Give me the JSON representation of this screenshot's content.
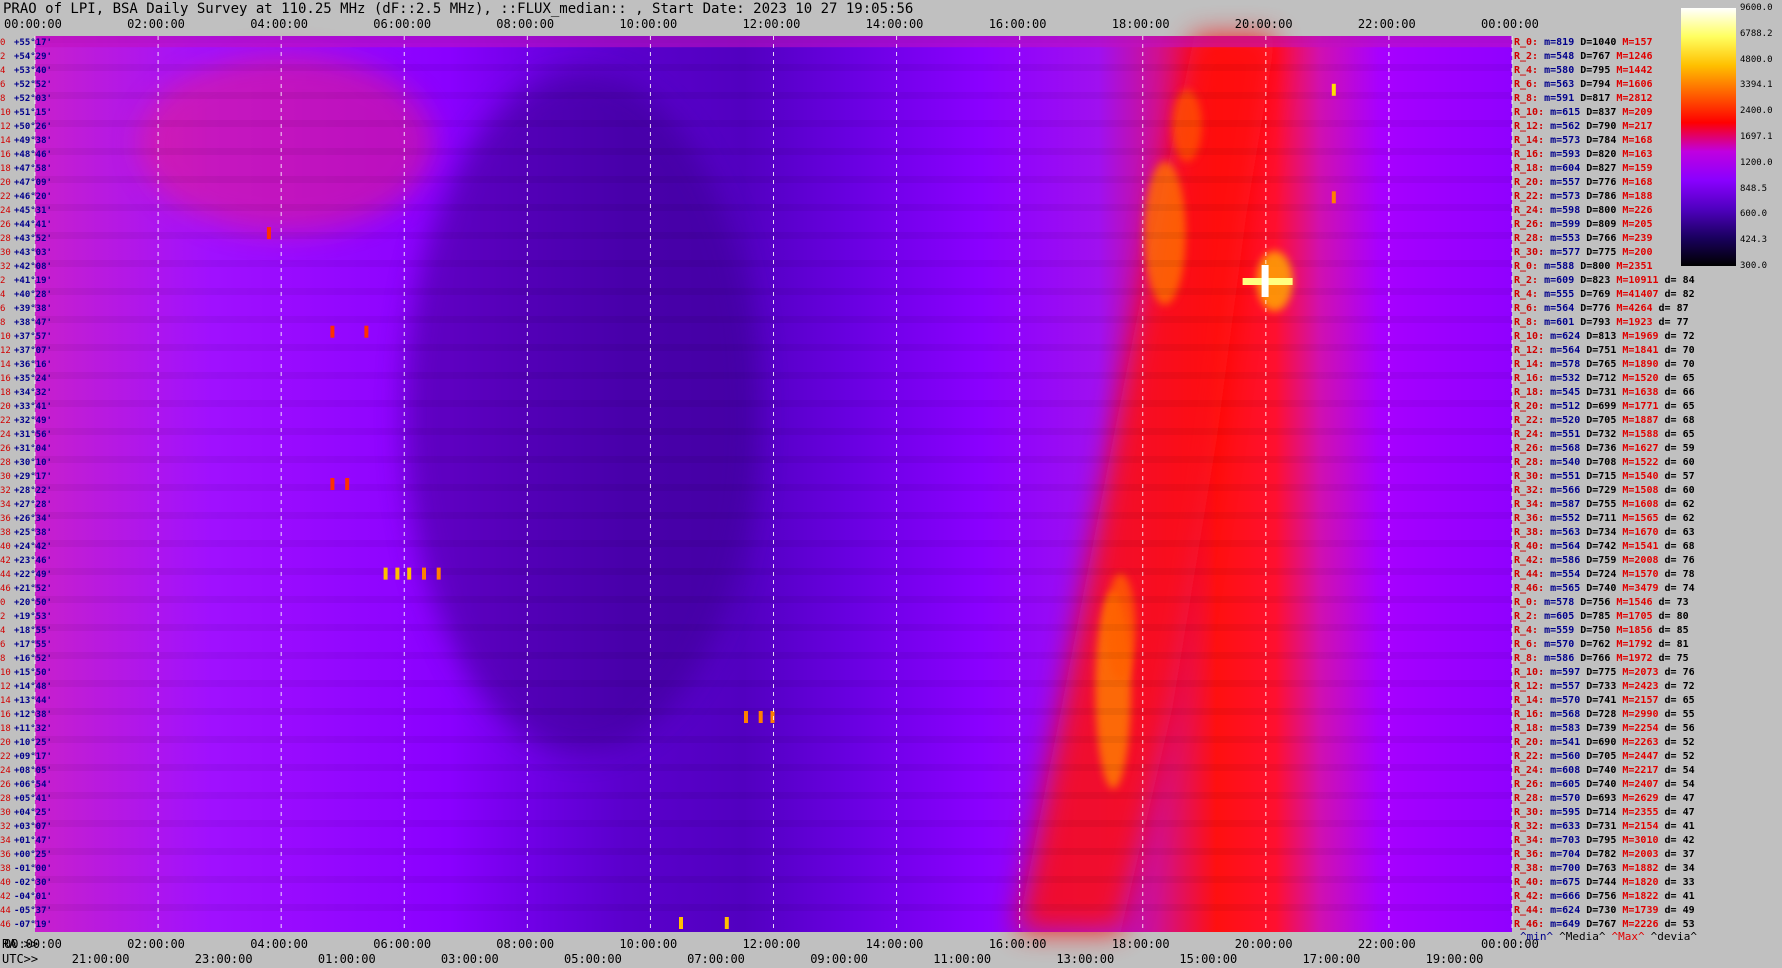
{
  "header": {
    "title": "PRAO of LPI, BSA Daily Survey at 110.25 MHz (dF::2.5 MHz), ::FLUX_median:: , Start Date: 2023 10 27 19:05:56"
  },
  "axes": {
    "top_ticks": [
      "00:00:00",
      "02:00:00",
      "04:00:00",
      "06:00:00",
      "08:00:00",
      "10:00:00",
      "12:00:00",
      "14:00:00",
      "16:00:00",
      "18:00:00",
      "20:00:00",
      "22:00:00",
      "00:00:00"
    ],
    "bottom_ra_prefix": "RA >>",
    "bottom_ra_ticks": [
      "00:00:00",
      "02:00:00",
      "04:00:00",
      "06:00:00",
      "08:00:00",
      "10:00:00",
      "12:00:00",
      "14:00:00",
      "16:00:00",
      "18:00:00",
      "20:00:00",
      "22:00:00",
      "00:00:00"
    ],
    "bottom_utc_prefix": "UTC>>",
    "bottom_utc_ticks": [
      "21:00:00",
      "23:00:00",
      "01:00:00",
      "03:00:00",
      "05:00:00",
      "07:00:00",
      "09:00:00",
      "11:00:00",
      "13:00:00",
      "15:00:00",
      "17:00:00",
      "19:00:00"
    ]
  },
  "declinations": [
    {
      "i": "0",
      "d": "+55°17'"
    },
    {
      "i": "2",
      "d": "+54°29'"
    },
    {
      "i": "4",
      "d": "+53°40'"
    },
    {
      "i": "6",
      "d": "+52°52'"
    },
    {
      "i": "8",
      "d": "+52°03'"
    },
    {
      "i": "10",
      "d": "+51°15'"
    },
    {
      "i": "12",
      "d": "+50°26'"
    },
    {
      "i": "14",
      "d": "+49°38'"
    },
    {
      "i": "16",
      "d": "+48°46'"
    },
    {
      "i": "18",
      "d": "+47°58'"
    },
    {
      "i": "20",
      "d": "+47°09'"
    },
    {
      "i": "22",
      "d": "+46°20'"
    },
    {
      "i": "24",
      "d": "+45°31'"
    },
    {
      "i": "26",
      "d": "+44°41'"
    },
    {
      "i": "28",
      "d": "+43°52'"
    },
    {
      "i": "30",
      "d": "+43°03'"
    },
    {
      "i": "32",
      "d": "+42°08'"
    },
    {
      "i": "2",
      "d": "+41°19'"
    },
    {
      "i": "4",
      "d": "+40°28'"
    },
    {
      "i": "6",
      "d": "+39°38'"
    },
    {
      "i": "8",
      "d": "+38°47'"
    },
    {
      "i": "10",
      "d": "+37°57'"
    },
    {
      "i": "12",
      "d": "+37°07'"
    },
    {
      "i": "14",
      "d": "+36°16'"
    },
    {
      "i": "16",
      "d": "+35°24'"
    },
    {
      "i": "18",
      "d": "+34°32'"
    },
    {
      "i": "20",
      "d": "+33°41'"
    },
    {
      "i": "22",
      "d": "+32°49'"
    },
    {
      "i": "24",
      "d": "+31°56'"
    },
    {
      "i": "26",
      "d": "+31°04'"
    },
    {
      "i": "28",
      "d": "+30°10'"
    },
    {
      "i": "30",
      "d": "+29°17'"
    },
    {
      "i": "32",
      "d": "+28°22'"
    },
    {
      "i": "34",
      "d": "+27°28'"
    },
    {
      "i": "36",
      "d": "+26°34'"
    },
    {
      "i": "38",
      "d": "+25°38'"
    },
    {
      "i": "40",
      "d": "+24°42'"
    },
    {
      "i": "42",
      "d": "+23°46'"
    },
    {
      "i": "44",
      "d": "+22°49'"
    },
    {
      "i": "46",
      "d": "+21°52'"
    },
    {
      "i": "0",
      "d": "+20°50'"
    },
    {
      "i": "2",
      "d": "+19°53'"
    },
    {
      "i": "4",
      "d": "+18°55'"
    },
    {
      "i": "6",
      "d": "+17°55'"
    },
    {
      "i": "8",
      "d": "+16°52'"
    },
    {
      "i": "10",
      "d": "+15°50'"
    },
    {
      "i": "12",
      "d": "+14°48'"
    },
    {
      "i": "14",
      "d": "+13°44'"
    },
    {
      "i": "16",
      "d": "+12°38'"
    },
    {
      "i": "18",
      "d": "+11°32'"
    },
    {
      "i": "20",
      "d": "+10°25'"
    },
    {
      "i": "22",
      "d": "+09°17'"
    },
    {
      "i": "24",
      "d": "+08°05'"
    },
    {
      "i": "26",
      "d": "+06°54'"
    },
    {
      "i": "28",
      "d": "+05°41'"
    },
    {
      "i": "30",
      "d": "+04°25'"
    },
    {
      "i": "32",
      "d": "+03°07'"
    },
    {
      "i": "34",
      "d": "+01°47'"
    },
    {
      "i": "36",
      "d": "+00°25'"
    },
    {
      "i": "38",
      "d": "-01°00'"
    },
    {
      "i": "40",
      "d": "-02°30'"
    },
    {
      "i": "42",
      "d": "-04°01'"
    },
    {
      "i": "44",
      "d": "-05°37'"
    },
    {
      "i": "46",
      "d": "-07°19'"
    }
  ],
  "stats": [
    {
      "l": "R_0:",
      "m": "m=819",
      "D": "D=1040",
      "M": "M=157",
      "d": ""
    },
    {
      "l": "R_2:",
      "m": "m=548",
      "D": "D=767",
      "M": "M=1246",
      "d": ""
    },
    {
      "l": "R_4:",
      "m": "m=580",
      "D": "D=795",
      "M": "M=1442",
      "d": ""
    },
    {
      "l": "R_6:",
      "m": "m=563",
      "D": "D=794",
      "M": "M=1606",
      "d": ""
    },
    {
      "l": "R_8:",
      "m": "m=591",
      "D": "D=817",
      "M": "M=2812",
      "d": ""
    },
    {
      "l": "R_10:",
      "m": "m=615",
      "D": "D=837",
      "M": "M=209",
      "d": ""
    },
    {
      "l": "R_12:",
      "m": "m=562",
      "D": "D=790",
      "M": "M=217",
      "d": ""
    },
    {
      "l": "R_14:",
      "m": "m=573",
      "D": "D=784",
      "M": "M=168",
      "d": ""
    },
    {
      "l": "R_16:",
      "m": "m=593",
      "D": "D=820",
      "M": "M=163",
      "d": ""
    },
    {
      "l": "R_18:",
      "m": "m=604",
      "D": "D=827",
      "M": "M=159",
      "d": ""
    },
    {
      "l": "R_20:",
      "m": "m=557",
      "D": "D=776",
      "M": "M=168",
      "d": ""
    },
    {
      "l": "R_22:",
      "m": "m=573",
      "D": "D=786",
      "M": "M=188",
      "d": ""
    },
    {
      "l": "R_24:",
      "m": "m=598",
      "D": "D=800",
      "M": "M=226",
      "d": ""
    },
    {
      "l": "R_26:",
      "m": "m=599",
      "D": "D=809",
      "M": "M=205",
      "d": ""
    },
    {
      "l": "R_28:",
      "m": "m=553",
      "D": "D=766",
      "M": "M=239",
      "d": ""
    },
    {
      "l": "R_30:",
      "m": "m=577",
      "D": "D=775",
      "M": "M=200",
      "d": ""
    },
    {
      "l": "R_0:",
      "m": "m=588",
      "D": "D=800",
      "M": "M=2351",
      "d": ""
    },
    {
      "l": "R_2:",
      "m": "m=609",
      "D": "D=823",
      "M": "M=10911",
      "d": "d= 84"
    },
    {
      "l": "R_4:",
      "m": "m=555",
      "D": "D=769",
      "M": "M=41407",
      "d": "d= 82"
    },
    {
      "l": "R_6:",
      "m": "m=564",
      "D": "D=776",
      "M": "M=4264",
      "d": "d= 87"
    },
    {
      "l": "R_8:",
      "m": "m=601",
      "D": "D=793",
      "M": "M=1923",
      "d": "d= 77"
    },
    {
      "l": "R_10:",
      "m": "m=624",
      "D": "D=813",
      "M": "M=1969",
      "d": "d= 72"
    },
    {
      "l": "R_12:",
      "m": "m=564",
      "D": "D=751",
      "M": "M=1841",
      "d": "d= 70"
    },
    {
      "l": "R_14:",
      "m": "m=578",
      "D": "D=765",
      "M": "M=1890",
      "d": "d= 70"
    },
    {
      "l": "R_16:",
      "m": "m=532",
      "D": "D=712",
      "M": "M=1520",
      "d": "d= 65"
    },
    {
      "l": "R_18:",
      "m": "m=545",
      "D": "D=731",
      "M": "M=1638",
      "d": "d= 66"
    },
    {
      "l": "R_20:",
      "m": "m=512",
      "D": "D=699",
      "M": "M=1771",
      "d": "d= 65"
    },
    {
      "l": "R_22:",
      "m": "m=520",
      "D": "D=705",
      "M": "M=1887",
      "d": "d= 68"
    },
    {
      "l": "R_24:",
      "m": "m=551",
      "D": "D=732",
      "M": "M=1588",
      "d": "d= 65"
    },
    {
      "l": "R_26:",
      "m": "m=568",
      "D": "D=736",
      "M": "M=1627",
      "d": "d= 59"
    },
    {
      "l": "R_28:",
      "m": "m=540",
      "D": "D=708",
      "M": "M=1522",
      "d": "d= 60"
    },
    {
      "l": "R_30:",
      "m": "m=551",
      "D": "D=715",
      "M": "M=1540",
      "d": "d= 57"
    },
    {
      "l": "R_32:",
      "m": "m=566",
      "D": "D=729",
      "M": "M=1508",
      "d": "d= 60"
    },
    {
      "l": "R_34:",
      "m": "m=587",
      "D": "D=755",
      "M": "M=1608",
      "d": "d= 62"
    },
    {
      "l": "R_36:",
      "m": "m=552",
      "D": "D=711",
      "M": "M=1565",
      "d": "d= 62"
    },
    {
      "l": "R_38:",
      "m": "m=563",
      "D": "D=734",
      "M": "M=1670",
      "d": "d= 63"
    },
    {
      "l": "R_40:",
      "m": "m=564",
      "D": "D=742",
      "M": "M=1541",
      "d": "d= 68"
    },
    {
      "l": "R_42:",
      "m": "m=586",
      "D": "D=759",
      "M": "M=2008",
      "d": "d= 76"
    },
    {
      "l": "R_44:",
      "m": "m=554",
      "D": "D=724",
      "M": "M=1570",
      "d": "d= 78"
    },
    {
      "l": "R_46:",
      "m": "m=565",
      "D": "D=740",
      "M": "M=3479",
      "d": "d= 74"
    },
    {
      "l": "R_0:",
      "m": "m=578",
      "D": "D=756",
      "M": "M=1546",
      "d": "d= 73"
    },
    {
      "l": "R_2:",
      "m": "m=605",
      "D": "D=785",
      "M": "M=1705",
      "d": "d= 80"
    },
    {
      "l": "R_4:",
      "m": "m=559",
      "D": "D=750",
      "M": "M=1856",
      "d": "d= 85"
    },
    {
      "l": "R_6:",
      "m": "m=570",
      "D": "D=762",
      "M": "M=1792",
      "d": "d= 81"
    },
    {
      "l": "R_8:",
      "m": "m=586",
      "D": "D=766",
      "M": "M=1972",
      "d": "d= 75"
    },
    {
      "l": "R_10:",
      "m": "m=597",
      "D": "D=775",
      "M": "M=2073",
      "d": "d= 76"
    },
    {
      "l": "R_12:",
      "m": "m=557",
      "D": "D=733",
      "M": "M=2423",
      "d": "d= 72"
    },
    {
      "l": "R_14:",
      "m": "m=570",
      "D": "D=741",
      "M": "M=2157",
      "d": "d= 65"
    },
    {
      "l": "R_16:",
      "m": "m=568",
      "D": "D=728",
      "M": "M=2990",
      "d": "d= 55"
    },
    {
      "l": "R_18:",
      "m": "m=583",
      "D": "D=739",
      "M": "M=2254",
      "d": "d= 56"
    },
    {
      "l": "R_20:",
      "m": "m=541",
      "D": "D=690",
      "M": "M=2263",
      "d": "d= 52"
    },
    {
      "l": "R_22:",
      "m": "m=560",
      "D": "D=705",
      "M": "M=2447",
      "d": "d= 52"
    },
    {
      "l": "R_24:",
      "m": "m=608",
      "D": "D=740",
      "M": "M=2217",
      "d": "d= 54"
    },
    {
      "l": "R_26:",
      "m": "m=605",
      "D": "D=740",
      "M": "M=2407",
      "d": "d= 54"
    },
    {
      "l": "R_28:",
      "m": "m=570",
      "D": "D=693",
      "M": "M=2629",
      "d": "d= 47"
    },
    {
      "l": "R_30:",
      "m": "m=595",
      "D": "D=714",
      "M": "M=2355",
      "d": "d= 47"
    },
    {
      "l": "R_32:",
      "m": "m=633",
      "D": "D=731",
      "M": "M=2154",
      "d": "d= 41"
    },
    {
      "l": "R_34:",
      "m": "m=703",
      "D": "D=795",
      "M": "M=3010",
      "d": "d= 42"
    },
    {
      "l": "R_36:",
      "m": "m=704",
      "D": "D=782",
      "M": "M=2003",
      "d": "d= 37"
    },
    {
      "l": "R_38:",
      "m": "m=700",
      "D": "D=763",
      "M": "M=1882",
      "d": "d= 34"
    },
    {
      "l": "R_40:",
      "m": "m=675",
      "D": "D=744",
      "M": "M=1820",
      "d": "d= 33"
    },
    {
      "l": "R_42:",
      "m": "m=666",
      "D": "D=756",
      "M": "M=1822",
      "d": "d= 41"
    },
    {
      "l": "R_44:",
      "m": "m=624",
      "D": "D=730",
      "M": "M=1739",
      "d": "d= 49"
    },
    {
      "l": "R_46:",
      "m": "m=649",
      "D": "D=767",
      "M": "M=2226",
      "d": "d= 53"
    }
  ],
  "legend_keys": [
    {
      "text": "^min^",
      "color": "#00008b"
    },
    {
      "text": "^Media^",
      "color": "#000000"
    },
    {
      "text": "^Max^",
      "color": "#e00000"
    },
    {
      "text": "^devia^",
      "color": "#000000"
    }
  ],
  "colorbar": {
    "ticks": [
      "9600.0",
      "6788.2",
      "4800.0",
      "3394.1",
      "2400.0",
      "1697.1",
      "1200.0",
      "848.5",
      "600.0",
      "424.3",
      "300.0"
    ]
  },
  "chart_data": {
    "type": "heatmap",
    "title": "PRAO of LPI, BSA Daily Survey at 110.25 MHz (dF::2.5 MHz), ::FLUX_median:: , Start Date: 2023 10 27 19:05:56",
    "x_axis": "RA 00:00:00 - 24:00:00 (UTC 19:05:56 start)",
    "y_axis": "Declination +55°17' to -07°19'",
    "rows": 64,
    "colorbar_range": [
      300.0,
      9600.0
    ],
    "colorbar_scale": "log",
    "colormap": [
      "#000000",
      "#1a0060",
      "#5000c0",
      "#8a00ff",
      "#c000e0",
      "#ff0000",
      "#ff6000",
      "#ffc000",
      "#ffff60",
      "#ffffff"
    ],
    "grid": true,
    "features": [
      {
        "name": "milky-way-band",
        "ra_start_h": 17.2,
        "ra_end_h": 20.9,
        "dec": "full"
      },
      {
        "name": "bright-source",
        "ra_h": 19.98,
        "dec": "+41°19'"
      },
      {
        "name": "low-background",
        "ra_h": 9.5,
        "dec": "+33°41'"
      }
    ]
  }
}
